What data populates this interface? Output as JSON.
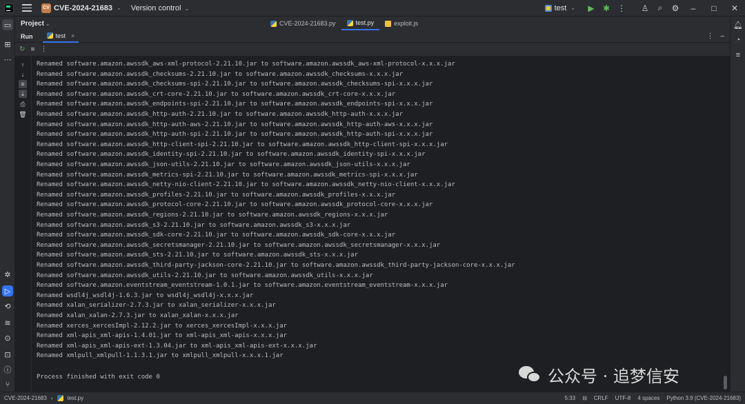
{
  "titlebar": {
    "project_badge": "CV",
    "project_name": "CVE-2024-21683",
    "vcs_label": "Version control",
    "run_config": "test"
  },
  "project_panel": {
    "label": "Project"
  },
  "editor_tabs": [
    {
      "label": "CVE-2024-21683.py",
      "icon": "python-file-icon"
    },
    {
      "label": "test.py",
      "icon": "python-file-icon",
      "active": true
    },
    {
      "label": "exploit.js",
      "icon": "js-file-icon"
    }
  ],
  "run_window": {
    "label": "Run",
    "tab_label": "test"
  },
  "console": {
    "lines": [
      "Renamed software.amazon.awssdk_aws-xml-protocol-2.21.10.jar to software.amazon.awssdk_aws-xml-protocol-x.x.x.jar",
      "Renamed software.amazon.awssdk_checksums-2.21.10.jar to software.amazon.awssdk_checksums-x.x.x.jar",
      "Renamed software.amazon.awssdk_checksums-spi-2.21.10.jar to software.amazon.awssdk_checksums-spi-x.x.x.jar",
      "Renamed software.amazon.awssdk_crt-core-2.21.10.jar to software.amazon.awssdk_crt-core-x.x.x.jar",
      "Renamed software.amazon.awssdk_endpoints-spi-2.21.10.jar to software.amazon.awssdk_endpoints-spi-x.x.x.jar",
      "Renamed software.amazon.awssdk_http-auth-2.21.10.jar to software.amazon.awssdk_http-auth-x.x.x.jar",
      "Renamed software.amazon.awssdk_http-auth-aws-2.21.10.jar to software.amazon.awssdk_http-auth-aws-x.x.x.jar",
      "Renamed software.amazon.awssdk_http-auth-spi-2.21.10.jar to software.amazon.awssdk_http-auth-spi-x.x.x.jar",
      "Renamed software.amazon.awssdk_http-client-spi-2.21.10.jar to software.amazon.awssdk_http-client-spi-x.x.x.jar",
      "Renamed software.amazon.awssdk_identity-spi-2.21.10.jar to software.amazon.awssdk_identity-spi-x.x.x.jar",
      "Renamed software.amazon.awssdk_json-utils-2.21.10.jar to software.amazon.awssdk_json-utils-x.x.x.jar",
      "Renamed software.amazon.awssdk_metrics-spi-2.21.10.jar to software.amazon.awssdk_metrics-spi-x.x.x.jar",
      "Renamed software.amazon.awssdk_netty-nio-client-2.21.10.jar to software.amazon.awssdk_netty-nio-client-x.x.x.jar",
      "Renamed software.amazon.awssdk_profiles-2.21.10.jar to software.amazon.awssdk_profiles-x.x.x.jar",
      "Renamed software.amazon.awssdk_protocol-core-2.21.10.jar to software.amazon.awssdk_protocol-core-x.x.x.jar",
      "Renamed software.amazon.awssdk_regions-2.21.10.jar to software.amazon.awssdk_regions-x.x.x.jar",
      "Renamed software.amazon.awssdk_s3-2.21.10.jar to software.amazon.awssdk_s3-x.x.x.jar",
      "Renamed software.amazon.awssdk_sdk-core-2.21.10.jar to software.amazon.awssdk_sdk-core-x.x.x.jar",
      "Renamed software.amazon.awssdk_secretsmanager-2.21.10.jar to software.amazon.awssdk_secretsmanager-x.x.x.jar",
      "Renamed software.amazon.awssdk_sts-2.21.10.jar to software.amazon.awssdk_sts-x.x.x.jar",
      "Renamed software.amazon.awssdk_third-party-jackson-core-2.21.10.jar to software.amazon.awssdk_third-party-jackson-core-x.x.x.jar",
      "Renamed software.amazon.awssdk_utils-2.21.10.jar to software.amazon.awssdk_utils-x.x.x.jar",
      "Renamed software.amazon.eventstream_eventstream-1.0.1.jar to software.amazon.eventstream_eventstream-x.x.x.jar",
      "Renamed wsdl4j_wsdl4j-1.6.3.jar to wsdl4j_wsdl4j-x.x.x.jar",
      "Renamed xalan_serializer-2.7.3.jar to xalan_serializer-x.x.x.jar",
      "Renamed xalan_xalan-2.7.3.jar to xalan_xalan-x.x.x.jar",
      "Renamed xerces_xercesImpl-2.12.2.jar to xerces_xercesImpl-x.x.x.jar",
      "Renamed xml-apis_xml-apis-1.4.01.jar to xml-apis_xml-apis-x.x.x.jar",
      "Renamed xml-apis_xml-apis-ext-1.3.04.jar to xml-apis_xml-apis-ext-x.x.x.jar",
      "Renamed xmlpull_xmlpull-1.1.3.1.jar to xmlpull_xmlpull-x.x.x.1.jar"
    ],
    "exit_message": "Process finished with exit code 0"
  },
  "watermark": {
    "text": "公众号 · 追梦信安"
  },
  "statusbar": {
    "breadcrumb_project": "CVE-2024-21683",
    "breadcrumb_file": "test.py",
    "position": "5:33",
    "line_separator": "CRLF",
    "encoding": "UTF-8",
    "indent": "4 spaces",
    "interpreter": "Python 3.9 (CVE-2024-21683)"
  },
  "colors": {
    "background": "#1e1f22",
    "panel": "#2b2d30",
    "accent": "#3574f0",
    "run_green": "#5fb85f",
    "project_badge": "#c27d4c"
  }
}
